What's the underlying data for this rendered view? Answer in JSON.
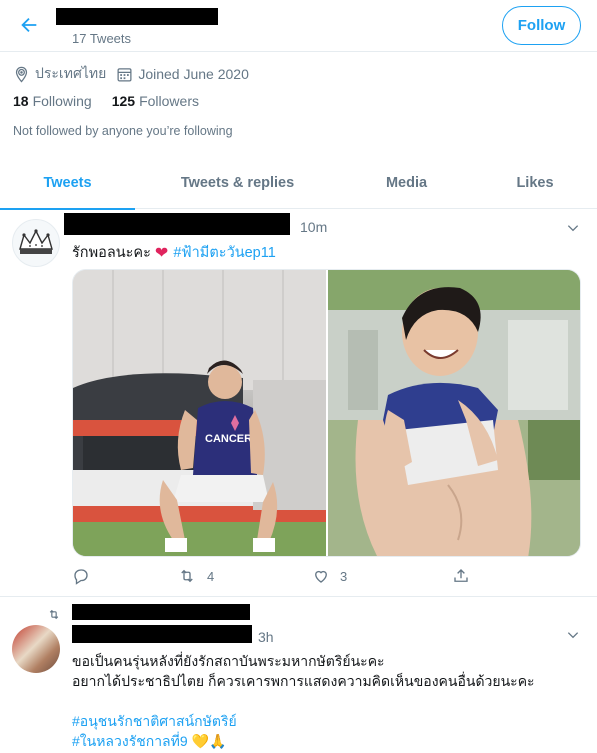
{
  "header": {
    "tweet_count": "17 Tweets",
    "follow_label": "Follow"
  },
  "profile": {
    "location": "ประเทศไทย",
    "joined": "Joined June 2020",
    "following_count": "18",
    "following_label": "Following",
    "followers_count": "125",
    "followers_label": "Followers",
    "not_followed_text": "Not followed by anyone you’re following"
  },
  "tabs": [
    {
      "label": "Tweets",
      "active": true
    },
    {
      "label": "Tweets & replies",
      "active": false
    },
    {
      "label": "Media",
      "active": false
    },
    {
      "label": "Likes",
      "active": false
    }
  ],
  "tweets": [
    {
      "time": "10m",
      "text": "รักพอลนะคะ",
      "emoji": "❤",
      "hashtag": "#ฟ้ามีตะวันep11",
      "replies": "",
      "retweets": "4",
      "likes": "3"
    },
    {
      "time": "3h",
      "line1": "ขอเป็นคนรุ่นหลังที่ยังรักสถาบันพระมหากษัตริย์นะคะ",
      "line2": "อยากได้ประชาธิปไตย ก็ควรเคารพการแสดงความคิดเห็นของคนอื่นด้วยนะคะ",
      "hashtag1": "#อนุชนรักชาติศาสน์กษัตริย์",
      "hashtag2": "#ในหลวงรัชกาลที่9",
      "emojis": "💛🙏"
    }
  ],
  "colors": {
    "accent": "#1da1f2",
    "secondary_text": "#657786",
    "like_heart": "#e0245e",
    "border": "#e6ecf0"
  }
}
